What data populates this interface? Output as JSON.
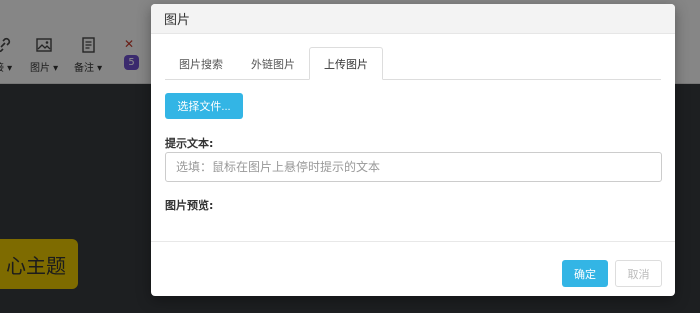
{
  "toolbar": {
    "link_label": "接 ▾",
    "image_label": "图片 ▾",
    "note_label": "备注 ▾",
    "badge_number": "5",
    "close_mark": "✕"
  },
  "canvas": {
    "topic_text": "心主题"
  },
  "dialog": {
    "title": "图片",
    "tabs": [
      "图片搜索",
      "外链图片",
      "上传图片"
    ],
    "active_tab": "上传图片",
    "choose_file_label": "选择文件...",
    "hint_label": "提示文本:",
    "hint_placeholder": "选填：鼠标在图片上悬停时提示的文本",
    "hint_value": "",
    "preview_label": "图片预览:",
    "ok_label": "确定",
    "cancel_label": "取消"
  },
  "colors": {
    "accent": "#33b5e5",
    "topic": "#e6c400",
    "badge": "#6c4fc9",
    "canvas": "#353a3c"
  }
}
